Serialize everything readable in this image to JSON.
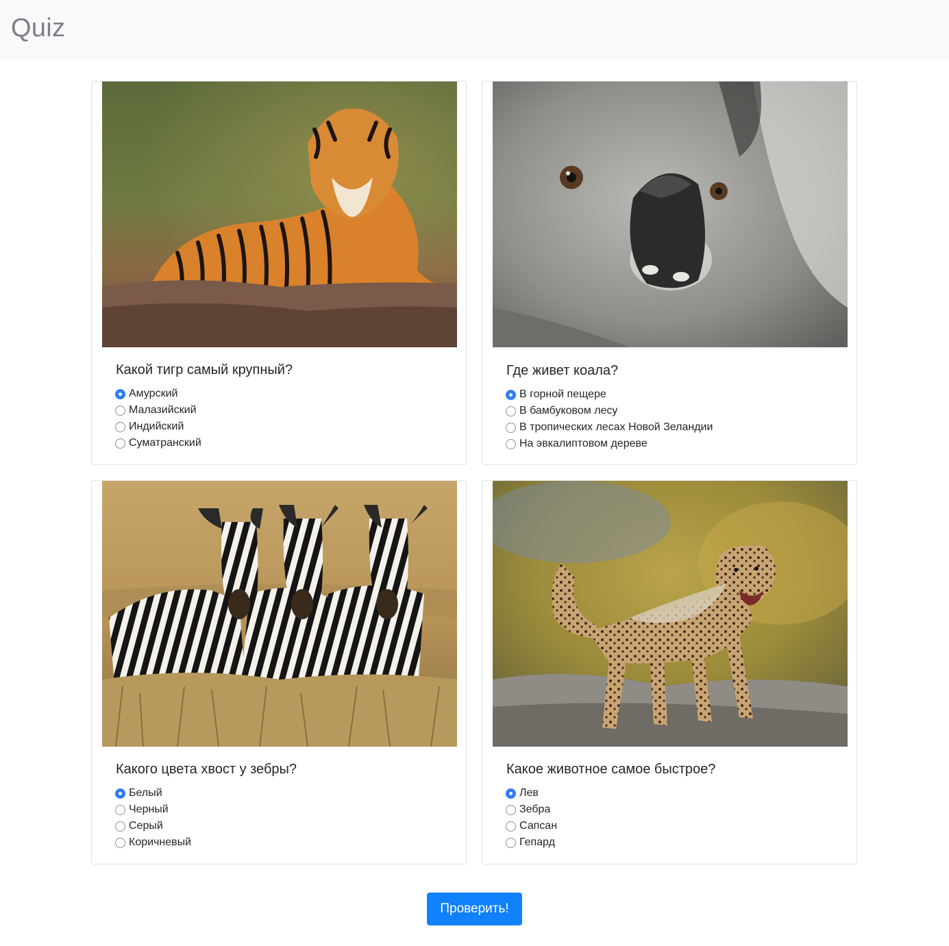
{
  "navbar": {
    "brand": "Quiz"
  },
  "questions": [
    {
      "image": "tiger-photo",
      "question": "Какой тигр самый крупный?",
      "options": [
        "Амурский",
        "Малазийский",
        "Индийский",
        "Суматранский"
      ],
      "selected": 0
    },
    {
      "image": "koala-photo",
      "question": "Где живет коала?",
      "options": [
        "В горной пещере",
        "В бамбуковом лесу",
        "В тропических лесах Новой Зеландии",
        "На эвкалиптовом дереве"
      ],
      "selected": 0
    },
    {
      "image": "zebras-photo",
      "question": "Какого цвета хвост у зебры?",
      "options": [
        "Белый",
        "Черный",
        "Серый",
        "Коричневый"
      ],
      "selected": 0
    },
    {
      "image": "cheetah-cub-photo",
      "question": "Какое животное самое быстрое?",
      "options": [
        "Лев",
        "Зебра",
        "Сапсан",
        "Гепард"
      ],
      "selected": 0
    }
  ],
  "submit": {
    "label": "Проверить!"
  },
  "colors": {
    "accent": "#1180fb",
    "radio_checked": "#2f7df6",
    "navbar_bg": "#f8f9fa"
  }
}
